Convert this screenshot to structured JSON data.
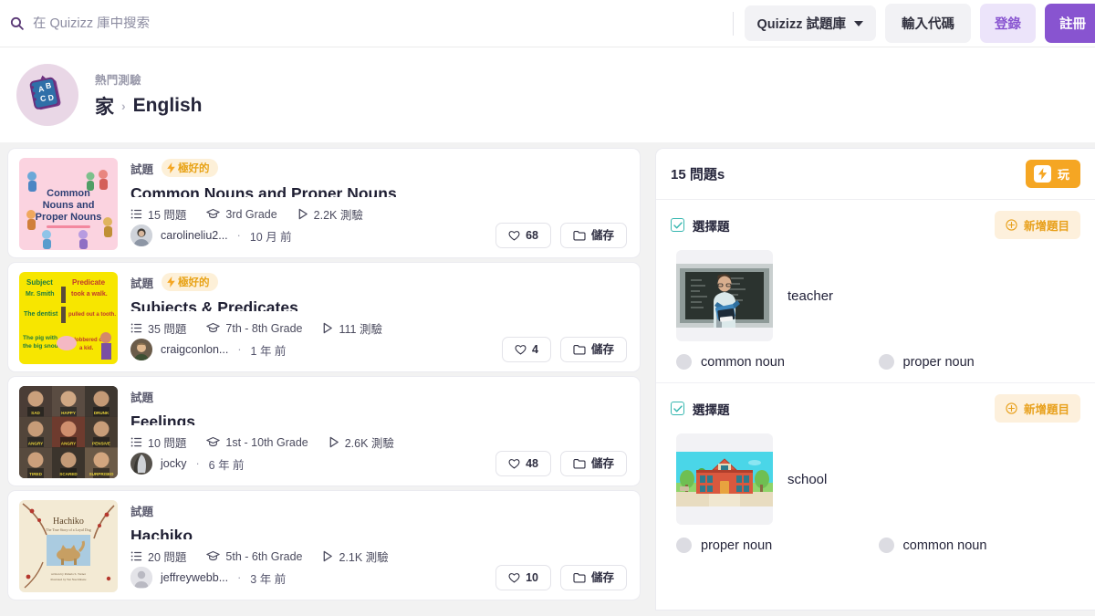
{
  "header": {
    "search": {
      "icon": "search-icon",
      "placeholder": "在 Quizizz 庫中搜索",
      "value": ""
    },
    "library_select": {
      "label": "Quizizz 試題庫",
      "icon": "chevron-down-icon"
    },
    "enter_code_label": "輸入代碼",
    "login_label": "登錄",
    "signup_label": "註冊",
    "colors": {
      "accent": "#8854d0",
      "login_bg": "#ece4fa",
      "neutral_bg": "#f2f2f5"
    }
  },
  "breadcrumb": {
    "logo_icon": "abcd-flashcard-icon",
    "kicker": "熱門測驗",
    "home_label": "家",
    "separator": "›",
    "current_label": "English"
  },
  "results": {
    "cards": [
      {
        "thumb_icon": "common-nouns-thumbnail",
        "tag": "試題",
        "badge": {
          "label": "極好的",
          "icon": "bolt-icon"
        },
        "title": "Common Nouns and Proper Nouns",
        "questions": "15 問題",
        "grade": "3rd Grade",
        "plays": "2.2K 測驗",
        "author": "carolineliu2...",
        "time": "10 月 前",
        "likes": "68",
        "save_label": "儲存"
      },
      {
        "thumb_icon": "subjects-predicates-thumbnail",
        "tag": "試題",
        "badge": {
          "label": "極好的",
          "icon": "bolt-icon"
        },
        "title": "Subjects & Predicates",
        "questions": "35 問題",
        "grade": "7th - 8th Grade",
        "plays": "111 測驗",
        "author": "craigconlon...",
        "time": "1 年 前",
        "likes": "4",
        "save_label": "儲存"
      },
      {
        "thumb_icon": "feelings-thumbnail",
        "tag": "試題",
        "badge": null,
        "title": "Feelings",
        "questions": "10 問題",
        "grade": "1st - 10th Grade",
        "plays": "2.6K 測驗",
        "author": "jocky",
        "time": "6 年 前",
        "likes": "48",
        "save_label": "儲存"
      },
      {
        "thumb_icon": "hachiko-thumbnail",
        "tag": "試題",
        "badge": null,
        "title": "Hachiko",
        "questions": "20 問題",
        "grade": "5th - 6th Grade",
        "plays": "2.1K 測驗",
        "author": "jeffreywebb...",
        "time": "3 年 前",
        "likes": "10",
        "save_label": "儲存"
      }
    ],
    "separator": "·",
    "icons": {
      "questions": "list-icon",
      "grade": "graduation-cap-icon",
      "plays": "play-triangle-icon",
      "like": "heart-icon",
      "save": "folder-icon"
    }
  },
  "preview": {
    "count_label": "15 問題s",
    "play_label": "玩",
    "play_icon": "lightning-bolt-icon",
    "questions": [
      {
        "type_label": "選擇題",
        "add_label": "新增題目",
        "add_icon": "plus-circle-icon",
        "media_icon": "teacher-photo",
        "text": "teacher",
        "options": [
          "common noun",
          "proper noun"
        ]
      },
      {
        "type_label": "選擇題",
        "add_label": "新增題目",
        "add_icon": "plus-circle-icon",
        "media_icon": "school-illustration",
        "text": "school",
        "options": [
          "proper noun",
          "common noun"
        ]
      }
    ],
    "colors": {
      "play_bg": "#f5a623",
      "add_bg": "#fdf0dc",
      "add_fg": "#e8a01b",
      "check": "#37b7b0"
    }
  }
}
